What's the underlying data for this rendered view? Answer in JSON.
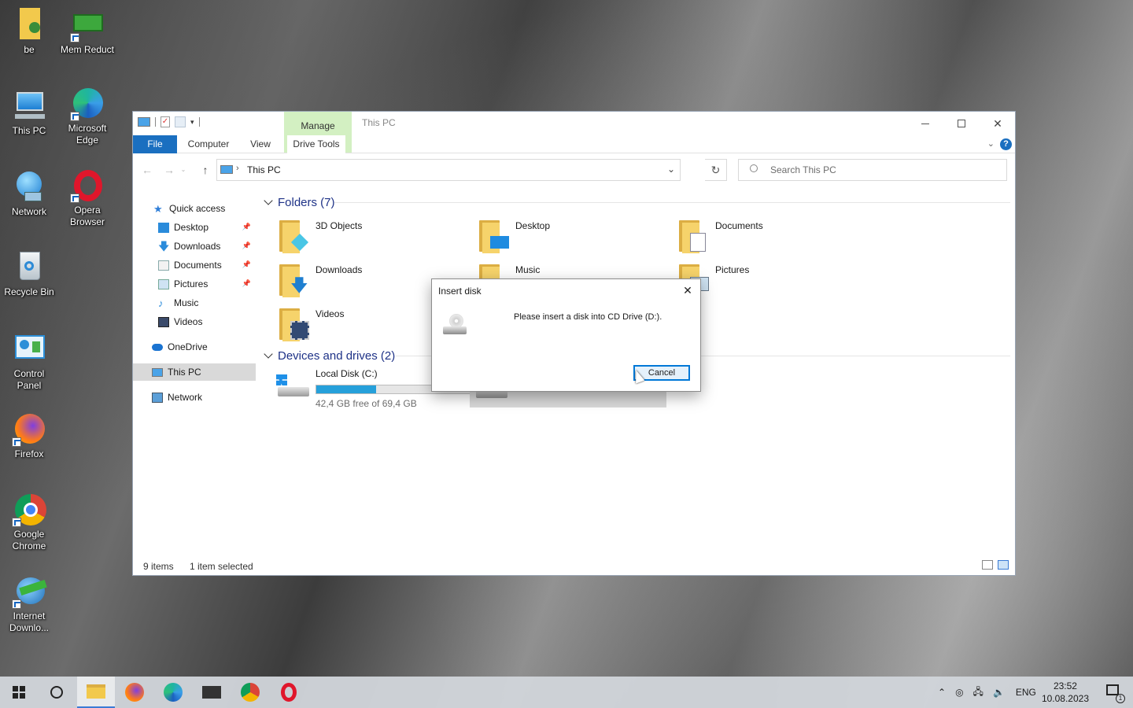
{
  "desktop": {
    "icons": [
      {
        "label": "be"
      },
      {
        "label": "Mem Reduct"
      },
      {
        "label": "This PC"
      },
      {
        "label": "Microsoft Edge"
      },
      {
        "label": "Network"
      },
      {
        "label": "Opera Browser"
      },
      {
        "label": "Recycle Bin"
      },
      {
        "label": "Control Panel"
      },
      {
        "label": "Firefox"
      },
      {
        "label": "Google Chrome"
      },
      {
        "label": "Internet Downlo..."
      }
    ]
  },
  "window": {
    "title": "This PC",
    "manage_tab": "Manage",
    "ribbon_tabs": [
      "File",
      "Computer",
      "View",
      "Drive Tools"
    ],
    "address": "This PC",
    "search_placeholder": "Search This PC",
    "sidebar": [
      {
        "label": "Quick access",
        "icon": "star-icon"
      },
      {
        "label": "Desktop",
        "icon": "desktop-icon",
        "pinned": true
      },
      {
        "label": "Downloads",
        "icon": "download-icon",
        "pinned": true
      },
      {
        "label": "Documents",
        "icon": "documents-icon",
        "pinned": true
      },
      {
        "label": "Pictures",
        "icon": "pictures-icon",
        "pinned": true
      },
      {
        "label": "Music",
        "icon": "music-icon"
      },
      {
        "label": "Videos",
        "icon": "videos-icon"
      },
      {
        "label": "OneDrive",
        "icon": "cloud-icon"
      },
      {
        "label": "This PC",
        "icon": "computer-icon",
        "selected": true
      },
      {
        "label": "Network",
        "icon": "network-icon"
      }
    ],
    "folders_header": "Folders (7)",
    "folders": [
      "3D Objects",
      "Desktop",
      "Documents",
      "Downloads",
      "Music",
      "Pictures",
      "Videos"
    ],
    "drives_header": "Devices and drives (2)",
    "drives": [
      {
        "name": "Local Disk (C:)",
        "free_text": "42,4 GB free of 69,4 GB",
        "used_fraction": 0.39
      }
    ],
    "status": {
      "items": "9 items",
      "selected": "1 item selected"
    }
  },
  "dialog": {
    "title": "Insert disk",
    "message": "Please insert a disk into CD Drive (D:).",
    "cancel": "Cancel"
  },
  "taskbar": {
    "language": "ENG",
    "time": "23:52",
    "date": "10.08.2023",
    "notification_count": "1"
  },
  "colors": {
    "accent": "#1a6fc0",
    "manage_tab": "#d3f0c2",
    "drive_bar": "#26a0da",
    "selection": "#d9d9d9"
  }
}
